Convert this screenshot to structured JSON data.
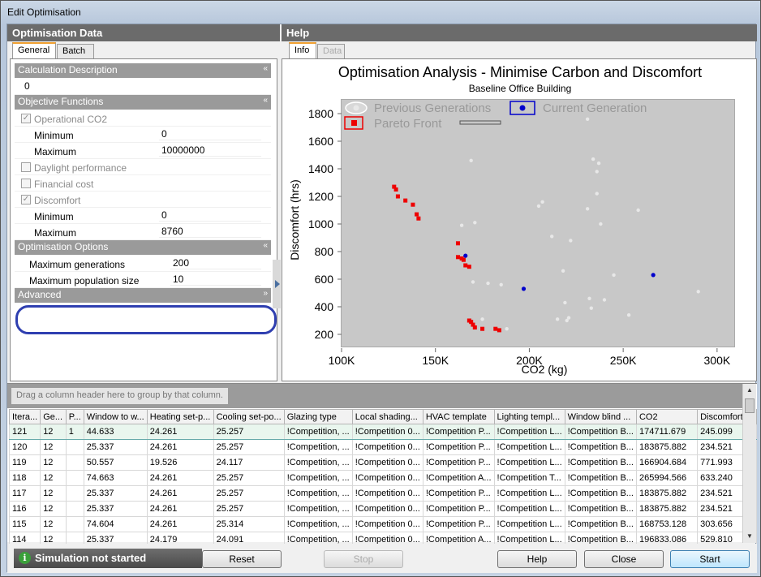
{
  "window": {
    "title": "Edit Optimisation"
  },
  "left_panel": {
    "header": "Optimisation Data",
    "tabs": [
      "General",
      "Batch"
    ],
    "categories": {
      "calc_desc": "Calculation Description",
      "objectives": "Objective Functions",
      "options": "Optimisation Options",
      "advanced": "Advanced"
    },
    "calc_desc_value": "0",
    "objectives": {
      "op_co2": {
        "label": "Operational CO2",
        "checked": true
      },
      "min1": {
        "label": "Minimum",
        "value": "0"
      },
      "max1": {
        "label": "Maximum",
        "value": "10000000"
      },
      "daylight": {
        "label": "Daylight performance",
        "checked": false
      },
      "financial": {
        "label": "Financial cost",
        "checked": false
      },
      "discomfort": {
        "label": "Discomfort",
        "checked": true
      },
      "min2": {
        "label": "Minimum",
        "value": "0"
      },
      "max2": {
        "label": "Maximum",
        "value": "8760"
      }
    },
    "options": {
      "max_gen": {
        "label": "Maximum generations",
        "value": "200"
      },
      "max_pop": {
        "label": "Maximum population size",
        "value": "10"
      }
    }
  },
  "right_panel": {
    "header": "Help",
    "tabs": [
      "Info",
      "Data"
    ]
  },
  "chart_data": {
    "type": "scatter",
    "title": "Optimisation Analysis - Minimise Carbon and Discomfort",
    "subtitle": "Baseline Office Building",
    "xlabel": "CO2 (kg)",
    "ylabel": "Discomfort (hrs)",
    "xlim": [
      100000,
      310000
    ],
    "ylim": [
      100,
      1900
    ],
    "x_ticks": [
      "100K",
      "150K",
      "200K",
      "250K",
      "300K"
    ],
    "x_tick_values": [
      100000,
      150000,
      200000,
      250000,
      300000
    ],
    "y_ticks": [
      "200",
      "400",
      "600",
      "800",
      "1000",
      "1200",
      "1400",
      "1600",
      "1800"
    ],
    "y_tick_values": [
      200,
      400,
      600,
      800,
      1000,
      1200,
      1400,
      1600,
      1800
    ],
    "legend": [
      "Previous Generations",
      "Current Generation",
      "Pareto Front"
    ],
    "colors": {
      "previous": "#e8e8e8",
      "current": "#0000cc",
      "pareto": "#ee0000",
      "plot_bg": "#c8c8c8"
    },
    "series": [
      {
        "name": "Previous Generations",
        "points": [
          [
            169000,
            1460
          ],
          [
            171000,
            1010
          ],
          [
            164000,
            990
          ],
          [
            170000,
            580
          ],
          [
            175000,
            310
          ],
          [
            178000,
            570
          ],
          [
            185000,
            560
          ],
          [
            188000,
            240
          ],
          [
            205000,
            1130
          ],
          [
            207000,
            1160
          ],
          [
            212000,
            910
          ],
          [
            215000,
            310
          ],
          [
            218000,
            660
          ],
          [
            219000,
            430
          ],
          [
            220000,
            300
          ],
          [
            221000,
            320
          ],
          [
            222000,
            880
          ],
          [
            231000,
            1760
          ],
          [
            234000,
            1470
          ],
          [
            236000,
            1380
          ],
          [
            237000,
            1440
          ],
          [
            236000,
            1220
          ],
          [
            231000,
            1110
          ],
          [
            232000,
            460
          ],
          [
            233000,
            390
          ],
          [
            238000,
            1000
          ],
          [
            240000,
            450
          ],
          [
            245000,
            630
          ],
          [
            253000,
            340
          ],
          [
            258000,
            1100
          ],
          [
            290000,
            510
          ]
        ]
      },
      {
        "name": "Current Generation",
        "points": [
          [
            166000,
            770
          ],
          [
            197000,
            530
          ],
          [
            266000,
            630
          ]
        ]
      },
      {
        "name": "Pareto Front",
        "points": [
          [
            128000,
            1270
          ],
          [
            129000,
            1250
          ],
          [
            130000,
            1200
          ],
          [
            134000,
            1170
          ],
          [
            138000,
            1140
          ],
          [
            140000,
            1070
          ],
          [
            141000,
            1040
          ],
          [
            162000,
            860
          ],
          [
            162000,
            760
          ],
          [
            164000,
            750
          ],
          [
            165000,
            740
          ],
          [
            166000,
            700
          ],
          [
            168000,
            690
          ],
          [
            168000,
            300
          ],
          [
            169000,
            290
          ],
          [
            170000,
            270
          ],
          [
            171000,
            250
          ],
          [
            175000,
            240
          ],
          [
            182000,
            240
          ],
          [
            184000,
            230
          ]
        ]
      }
    ]
  },
  "grid": {
    "group_hint": "Drag a column header here to group by that column.",
    "columns": [
      "Itera...",
      "Ge...",
      "P...",
      "Window to w...",
      "Heating set-p...",
      "Cooling set-po...",
      "Glazing type",
      "Local shading...",
      "HVAC template",
      "Lighting templ...",
      "Window blind ...",
      "CO2",
      "Discomfort"
    ],
    "rows": [
      [
        "121",
        "12",
        "1",
        "44.633",
        "24.261",
        "25.257",
        "!Competition, ...",
        "!Competition 0...",
        "!Competition P...",
        "!Competition L...",
        "!Competition B...",
        "174711.679",
        "245.099"
      ],
      [
        "120",
        "12",
        "",
        "25.337",
        "24.261",
        "25.257",
        "!Competition, ...",
        "!Competition 0...",
        "!Competition P...",
        "!Competition L...",
        "!Competition B...",
        "183875.882",
        "234.521"
      ],
      [
        "119",
        "12",
        "",
        "50.557",
        "19.526",
        "24.117",
        "!Competition, ...",
        "!Competition 0...",
        "!Competition P...",
        "!Competition L...",
        "!Competition B...",
        "166904.684",
        "771.993"
      ],
      [
        "118",
        "12",
        "",
        "74.663",
        "24.261",
        "25.257",
        "!Competition, ...",
        "!Competition 0...",
        "!Competition A...",
        "!Competition T...",
        "!Competition B...",
        "265994.566",
        "633.240"
      ],
      [
        "117",
        "12",
        "",
        "25.337",
        "24.261",
        "25.257",
        "!Competition, ...",
        "!Competition 0...",
        "!Competition P...",
        "!Competition L...",
        "!Competition B...",
        "183875.882",
        "234.521"
      ],
      [
        "116",
        "12",
        "",
        "25.337",
        "24.261",
        "25.257",
        "!Competition, ...",
        "!Competition 0...",
        "!Competition P...",
        "!Competition L...",
        "!Competition B...",
        "183875.882",
        "234.521"
      ],
      [
        "115",
        "12",
        "",
        "74.604",
        "24.261",
        "25.314",
        "!Competition, ...",
        "!Competition 0...",
        "!Competition P...",
        "!Competition L...",
        "!Competition B...",
        "168753.128",
        "303.656"
      ],
      [
        "114",
        "12",
        "",
        "25.337",
        "24.179",
        "24.091",
        "!Competition, ...",
        "!Competition 0...",
        "!Competition A...",
        "!Competition L...",
        "!Competition B...",
        "196833.086",
        "529.810"
      ]
    ]
  },
  "status": {
    "text": "Simulation not started"
  },
  "buttons": {
    "reset": "Reset",
    "stop": "Stop",
    "help": "Help",
    "close": "Close",
    "start": "Start"
  }
}
